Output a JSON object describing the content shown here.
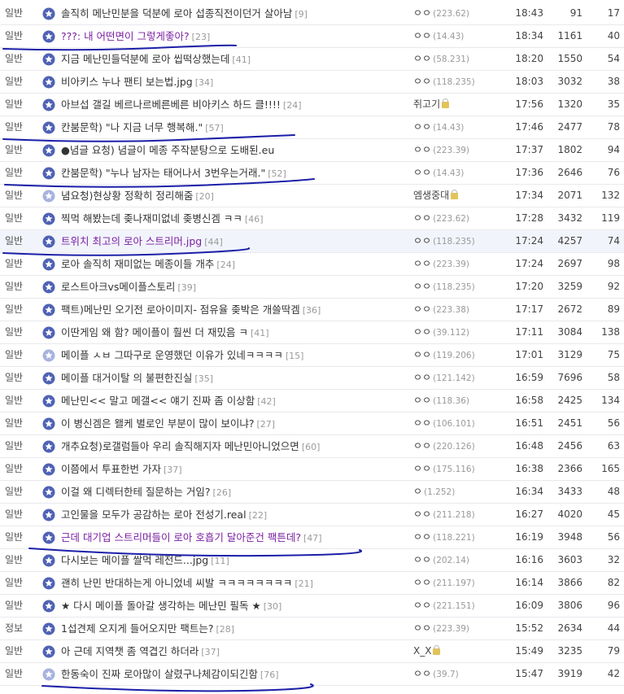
{
  "colors": {
    "visited_title": "#7a1fa2",
    "star_fill": "#4f62b4",
    "star_fill_light": "#a7b2de",
    "highlight_row": "#f2f4fb",
    "annotation_ink": "#1b1fa8"
  },
  "rows": [
    {
      "category": "일반",
      "star": "filled",
      "title": "솔직히 메난민분을 덕분에 로아 섭종직전이던거 살아남",
      "comments": "[9]",
      "author": "ㅇㅇ",
      "ip": "(223.62)",
      "lock": false,
      "time": "18:43",
      "views": "91",
      "recs": "17",
      "visited": false
    },
    {
      "category": "일반",
      "star": "filled",
      "title": "???: 내 어떤면이 그렇게좋아?",
      "comments": "[23]",
      "author": "ㅇㅇ",
      "ip": "(14.43)",
      "lock": false,
      "time": "18:34",
      "views": "1161",
      "recs": "40",
      "visited": true
    },
    {
      "category": "일반",
      "star": "filled",
      "title": "지금 메난민들덕분에 로아 씹떡상했는데",
      "comments": "[41]",
      "author": "ㅇㅇ",
      "ip": "(58.231)",
      "lock": false,
      "time": "18:20",
      "views": "1550",
      "recs": "54",
      "visited": false
    },
    {
      "category": "일반",
      "star": "filled",
      "title": "비아키스 누나 팬티 보는법.jpg",
      "comments": "[34]",
      "author": "ㅇㅇ",
      "ip": "(118.235)",
      "lock": false,
      "time": "18:03",
      "views": "3032",
      "recs": "38",
      "visited": false
    },
    {
      "category": "일반",
      "star": "filled",
      "title": "아브섭 갤길 베르나르베른베른 비아키스 하드 클!!!!",
      "comments": "[24]",
      "author": "쥐고기",
      "ip": "",
      "lock": true,
      "time": "17:56",
      "views": "1320",
      "recs": "35",
      "visited": false
    },
    {
      "category": "일반",
      "star": "filled",
      "title": "칸붐문학) \"나 지금 너무 행복해.\"",
      "comments": "[57]",
      "author": "ㅇㅇ",
      "ip": "(14.43)",
      "lock": false,
      "time": "17:46",
      "views": "2477",
      "recs": "78",
      "visited": false
    },
    {
      "category": "일반",
      "star": "filled",
      "title": "●념글 요청) 념글이 메종 주작분탕으로 도배된.eu",
      "comments": "",
      "author": "ㅇㅇ",
      "ip": "(223.39)",
      "lock": false,
      "time": "17:37",
      "views": "1802",
      "recs": "94",
      "visited": false
    },
    {
      "category": "일반",
      "star": "filled",
      "title": "칸붐문학) \"누나 남자는 태어나서 3번우는거래.\"",
      "comments": "[52]",
      "author": "ㅇㅇ",
      "ip": "(14.43)",
      "lock": false,
      "time": "17:36",
      "views": "2646",
      "recs": "76",
      "visited": false
    },
    {
      "category": "일반",
      "star": "light",
      "title": "념요청)현상황 정확히 정리해줌",
      "comments": "[20]",
      "author": "엠생중대",
      "ip": "",
      "lock": true,
      "time": "17:34",
      "views": "2071",
      "recs": "132",
      "visited": false
    },
    {
      "category": "일반",
      "star": "filled",
      "title": "찍먹 해봤는데 좆나재미없네 좆병신겜 ㅋㅋ",
      "comments": "[46]",
      "author": "ㅇㅇ",
      "ip": "(223.62)",
      "lock": false,
      "time": "17:28",
      "views": "3432",
      "recs": "119",
      "visited": false
    },
    {
      "category": "일반",
      "star": "filled",
      "title": "트위치 최고의 로아 스트리머.jpg",
      "comments": "[44]",
      "author": "ㅇㅇ",
      "ip": "(118.235)",
      "lock": false,
      "time": "17:24",
      "views": "4257",
      "recs": "74",
      "visited": true,
      "highlight": true
    },
    {
      "category": "일반",
      "star": "filled",
      "title": "로아 솔직히 재미없는 메종이들 개추",
      "comments": "[24]",
      "author": "ㅇㅇ",
      "ip": "(223.39)",
      "lock": false,
      "time": "17:24",
      "views": "2697",
      "recs": "98",
      "visited": false
    },
    {
      "category": "일반",
      "star": "filled",
      "title": "로스트아크vs메이플스토리",
      "comments": "[39]",
      "author": "ㅇㅇ",
      "ip": "(118.235)",
      "lock": false,
      "time": "17:20",
      "views": "3259",
      "recs": "92",
      "visited": false
    },
    {
      "category": "일반",
      "star": "filled",
      "title": "팩트)메난민 오기전 로아이미지- 점유율 좆박은 개쓸딱겜",
      "comments": "[36]",
      "author": "ㅇㅇ",
      "ip": "(223.38)",
      "lock": false,
      "time": "17:17",
      "views": "2672",
      "recs": "89",
      "visited": false
    },
    {
      "category": "일반",
      "star": "filled",
      "title": "이딴게임 왜 함? 메이플이 훨씬 더 재밌음 ㅋ",
      "comments": "[41]",
      "author": "ㅇㅇ",
      "ip": "(39.112)",
      "lock": false,
      "time": "17:11",
      "views": "3084",
      "recs": "138",
      "visited": false
    },
    {
      "category": "일반",
      "star": "light",
      "title": "메이플 ㅅㅂ 그따구로 운영했던 이유가 있네ㅋㅋㅋㅋ",
      "comments": "[15]",
      "author": "ㅇㅇ",
      "ip": "(119.206)",
      "lock": false,
      "time": "17:01",
      "views": "3129",
      "recs": "75",
      "visited": false
    },
    {
      "category": "일반",
      "star": "filled",
      "title": "메이플 대거이탈 의 불편한진실",
      "comments": "[35]",
      "author": "ㅇㅇ",
      "ip": "(121.142)",
      "lock": false,
      "time": "16:59",
      "views": "7696",
      "recs": "58",
      "visited": false
    },
    {
      "category": "일반",
      "star": "filled",
      "title": "메난민<< 말고 메갤<< 얘기 진짜 좀 이상함",
      "comments": "[42]",
      "author": "ㅇㅇ",
      "ip": "(118.36)",
      "lock": false,
      "time": "16:58",
      "views": "2425",
      "recs": "134",
      "visited": false
    },
    {
      "category": "일반",
      "star": "filled",
      "title": "이 병신겜은 왤케 별로인 부분이 많이 보이냐?",
      "comments": "[27]",
      "author": "ㅇㅇ",
      "ip": "(106.101)",
      "lock": false,
      "time": "16:51",
      "views": "2451",
      "recs": "56",
      "visited": false
    },
    {
      "category": "일반",
      "star": "filled",
      "title": "개추요청)로갤럼들아 우리 솔직해지자 메난민아니었으면",
      "comments": "[60]",
      "author": "ㅇㅇ",
      "ip": "(220.126)",
      "lock": false,
      "time": "16:48",
      "views": "2456",
      "recs": "63",
      "visited": false
    },
    {
      "category": "일반",
      "star": "filled",
      "title": "이쯤에서 투표한번 가자",
      "comments": "[37]",
      "author": "ㅇㅇ",
      "ip": "(175.116)",
      "lock": false,
      "time": "16:38",
      "views": "2366",
      "recs": "165",
      "visited": false
    },
    {
      "category": "일반",
      "star": "filled",
      "title": "이걸 왜 디렉터한테 질문하는 거임?",
      "comments": "[26]",
      "author": "ㅇ",
      "ip": "(1.252)",
      "lock": false,
      "time": "16:34",
      "views": "3433",
      "recs": "48",
      "visited": false
    },
    {
      "category": "일반",
      "star": "filled",
      "title": "고인물을 모두가 공감하는 로아 전성기.real",
      "comments": "[22]",
      "author": "ㅇㅇ",
      "ip": "(211.218)",
      "lock": false,
      "time": "16:27",
      "views": "4020",
      "recs": "45",
      "visited": false
    },
    {
      "category": "일반",
      "star": "filled",
      "title": "근데 대기업 스트리머들이 로아 호흡기 달아준건 팩튼데?",
      "comments": "[47]",
      "author": "ㅇㅇ",
      "ip": "(118.221)",
      "lock": false,
      "time": "16:19",
      "views": "3948",
      "recs": "56",
      "visited": true
    },
    {
      "category": "일반",
      "star": "filled",
      "title": "다시보는 메이플 쌀먹 레전드...jpg",
      "comments": "[11]",
      "author": "ㅇㅇ",
      "ip": "(202.14)",
      "lock": false,
      "time": "16:16",
      "views": "3603",
      "recs": "32",
      "visited": false
    },
    {
      "category": "일반",
      "star": "filled",
      "title": "괜히 난민 반대하는게 아니었네 씨발 ㅋㅋㅋㅋㅋㅋㅋㅋ",
      "comments": "[21]",
      "author": "ㅇㅇ",
      "ip": "(211.197)",
      "lock": false,
      "time": "16:14",
      "views": "3866",
      "recs": "82",
      "visited": false
    },
    {
      "category": "일반",
      "star": "filled",
      "title": "★ 다시 메이플 돌아갈 생각하는 메난민 필독 ★",
      "comments": "[30]",
      "author": "ㅇㅇ",
      "ip": "(221.151)",
      "lock": false,
      "time": "16:09",
      "views": "3806",
      "recs": "96",
      "visited": false
    },
    {
      "category": "정보",
      "star": "filled",
      "title": "1섭견제 오지게 들어오지만 팩트는?",
      "comments": "[28]",
      "author": "ㅇㅇ",
      "ip": "(223.39)",
      "lock": false,
      "time": "15:52",
      "views": "2634",
      "recs": "44",
      "visited": false
    },
    {
      "category": "일반",
      "star": "filled",
      "title": "아 근데 지역챗 좀 역겹긴 하더라",
      "comments": "[37]",
      "author": "X_X",
      "ip": "",
      "lock": true,
      "time": "15:49",
      "views": "3235",
      "recs": "79",
      "visited": false
    },
    {
      "category": "일반",
      "star": "light",
      "title": "한동숙이 진짜 로아많이 살렸구나체감이되긴함",
      "comments": "[76]",
      "author": "ㅇㅇ",
      "ip": "(39.7)",
      "lock": false,
      "time": "15:47",
      "views": "3919",
      "recs": "42",
      "visited": false
    }
  ]
}
